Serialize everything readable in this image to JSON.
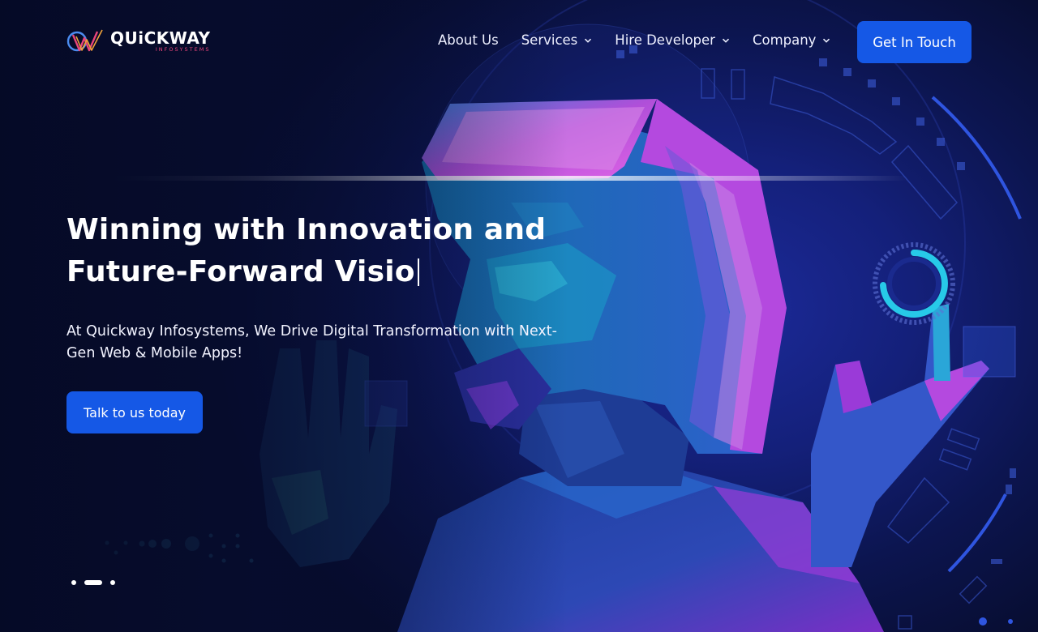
{
  "brand": {
    "name": "QUiCKWAY",
    "tagline": "INFOSYSTEMS"
  },
  "nav": {
    "items": [
      {
        "label": "About Us",
        "has_dropdown": false
      },
      {
        "label": "Services",
        "has_dropdown": true
      },
      {
        "label": "Hire Developer",
        "has_dropdown": true
      },
      {
        "label": "Company",
        "has_dropdown": true
      }
    ],
    "cta_label": "Get In Touch"
  },
  "hero": {
    "headline_line1": "Winning with Innovation and",
    "headline_line2": "Future-Forward Visio",
    "subtitle": "At Quickway Infosystems, We Drive Digital Transformation with Next-Gen Web & Mobile Apps!",
    "cta_label": "Talk to us today"
  },
  "slider": {
    "count": 3,
    "active_index": 1
  },
  "colors": {
    "accent": "#1558e6",
    "background": "#0b1238",
    "neon_cyan": "#27c9e8",
    "neon_magenta": "#c23ee0"
  },
  "icons": {
    "dropdown": "chevron-down-icon",
    "logo": "quickway-logo-icon"
  }
}
